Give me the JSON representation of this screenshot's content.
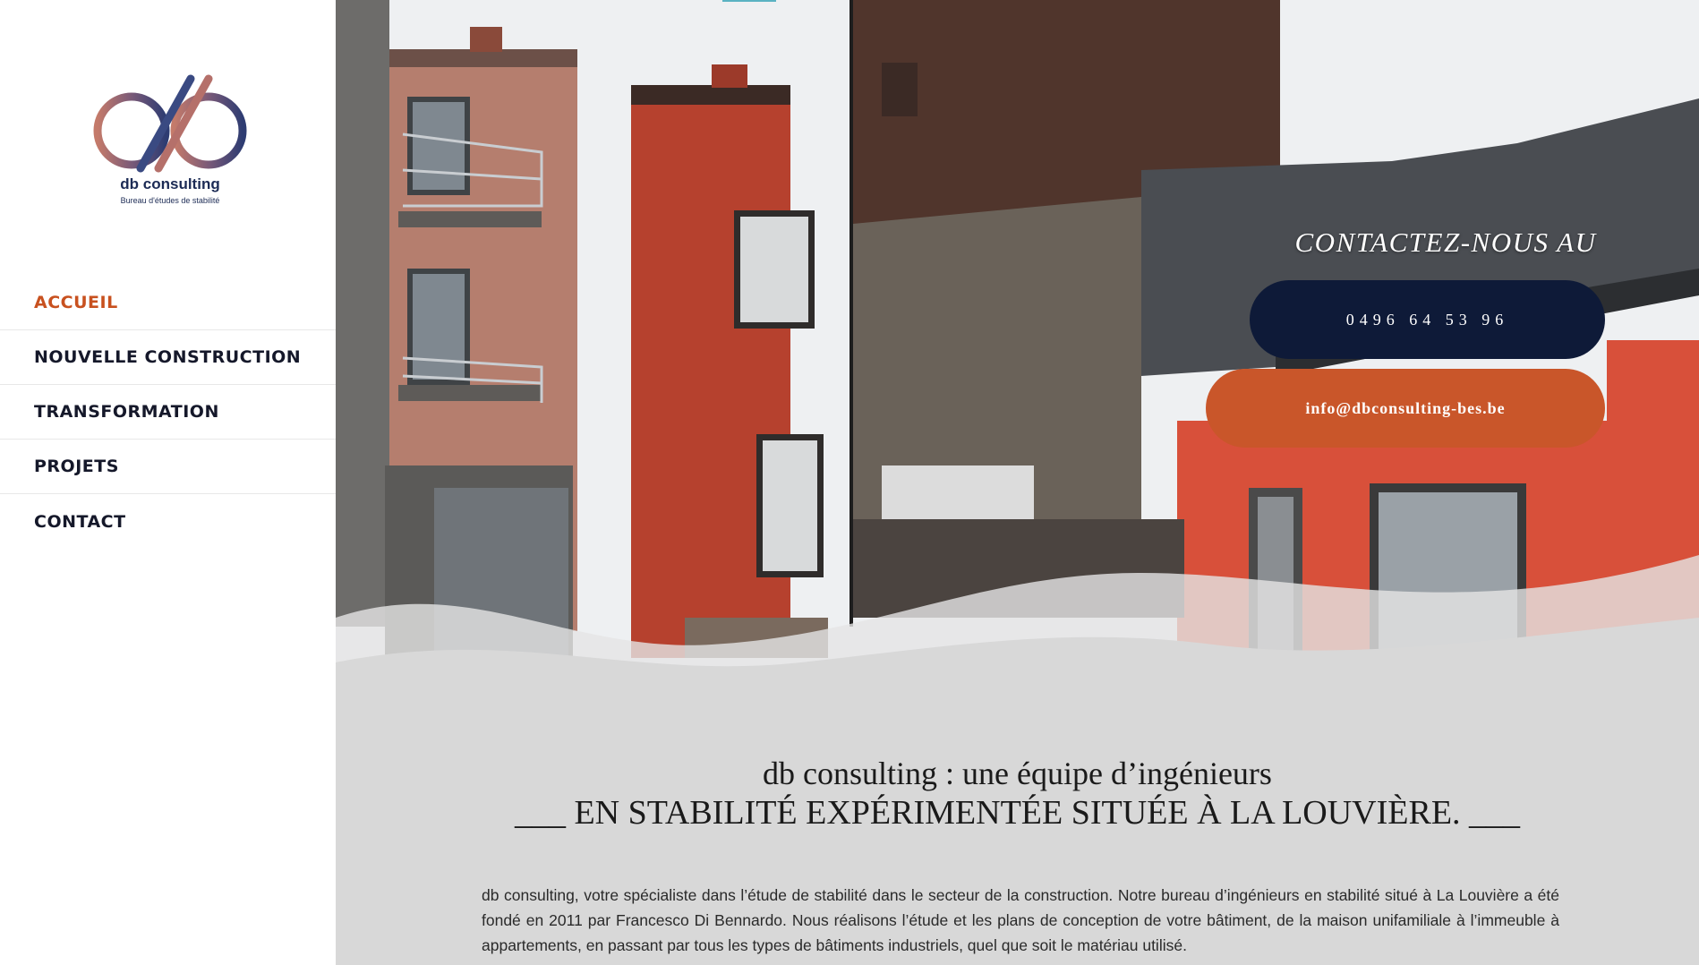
{
  "brand": {
    "name": "db consulting",
    "tagline": "Bureau d'études de stabilité"
  },
  "nav": {
    "items": [
      {
        "label": "ACCUEIL",
        "active": true
      },
      {
        "label": "NOUVELLE CONSTRUCTION",
        "active": false
      },
      {
        "label": "TRANSFORMATION",
        "active": false
      },
      {
        "label": "PROJETS",
        "active": false
      },
      {
        "label": "CONTACT",
        "active": false
      }
    ]
  },
  "hero": {
    "contact_title": "CONTACTEZ-NOUS AU",
    "phone": "0496 64 53 96",
    "email": "info@dbconsulting-bes.be"
  },
  "content": {
    "heading_line1": "db consulting : une équipe d’ingénieurs",
    "heading_line2": "___ EN STABILITÉ EXPÉRIMENTÉE SITUÉE À LA LOUVIÈRE. ___",
    "paragraph": "db consulting, votre spécialiste dans l’étude de stabilité dans le secteur de la construction. Notre bureau d’ingénieurs en stabilité situé à La Louvière a été fondé en 2011 par Francesco Di Bennardo. Nous réalisons l’étude et les plans de conception de votre bâtiment, de la maison unifamiliale à l’immeuble à appartements, en passant par tous les types de bâtiments industriels, quel que soit le matériau utilisé."
  },
  "colors": {
    "accent_orange": "#c9562a",
    "navy": "#0e1a38",
    "nav_active": "#c8511f",
    "content_bg": "#d8d8d8"
  }
}
